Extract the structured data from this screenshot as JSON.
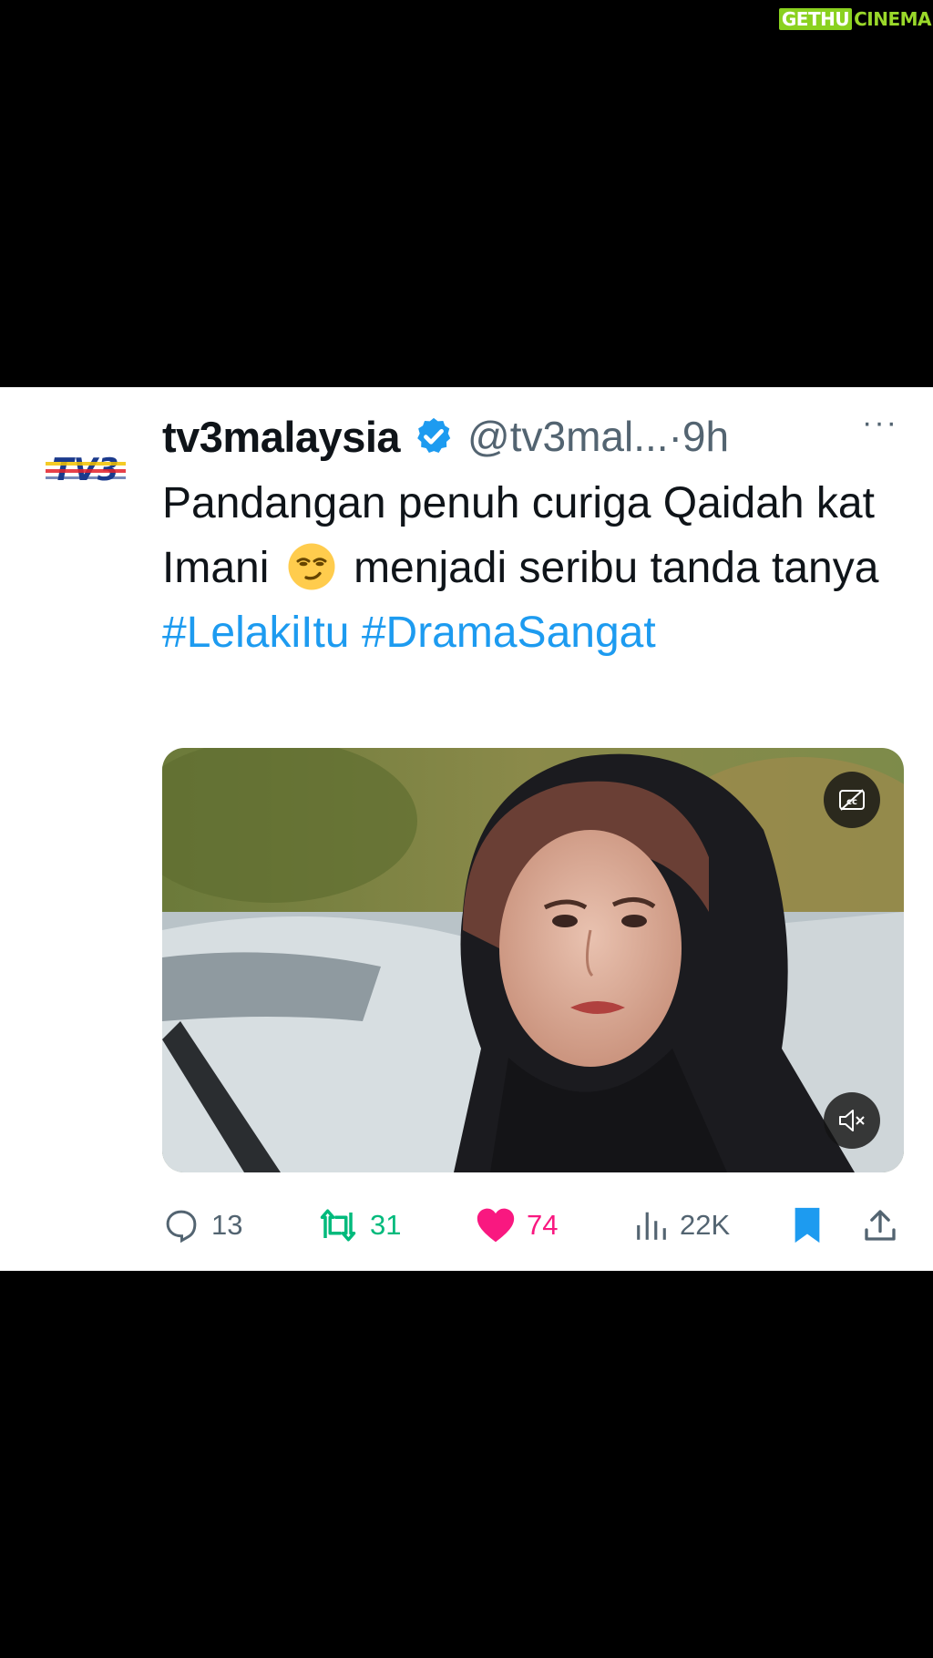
{
  "watermark": {
    "part1": "GETHU",
    "part2": "CINEMA"
  },
  "tweet": {
    "display_name": "tv3malaysia",
    "avatar_text": "TV3",
    "handle_time": "@tv3mal...·9h",
    "more_label": "···",
    "text_part1": "Pandangan penuh curiga Qaidah kat Imani",
    "text_part2": "menjadi seribu tanda tanya",
    "hashtag1": "#LelakiItu",
    "hashtag2": "#DramaSangat",
    "emoji_name": "smirking-face"
  },
  "media": {
    "type": "video",
    "captions_icon": "captions-off-icon",
    "mute_icon": "muted-speaker-icon"
  },
  "stats": {
    "replies": "13",
    "reposts": "31",
    "likes": "74",
    "views": "22K"
  },
  "colors": {
    "link": "#1d9bf0",
    "repost": "#00ba7c",
    "like": "#f91880",
    "bookmark": "#1d9bf0",
    "verified": "#1d9bf0"
  }
}
